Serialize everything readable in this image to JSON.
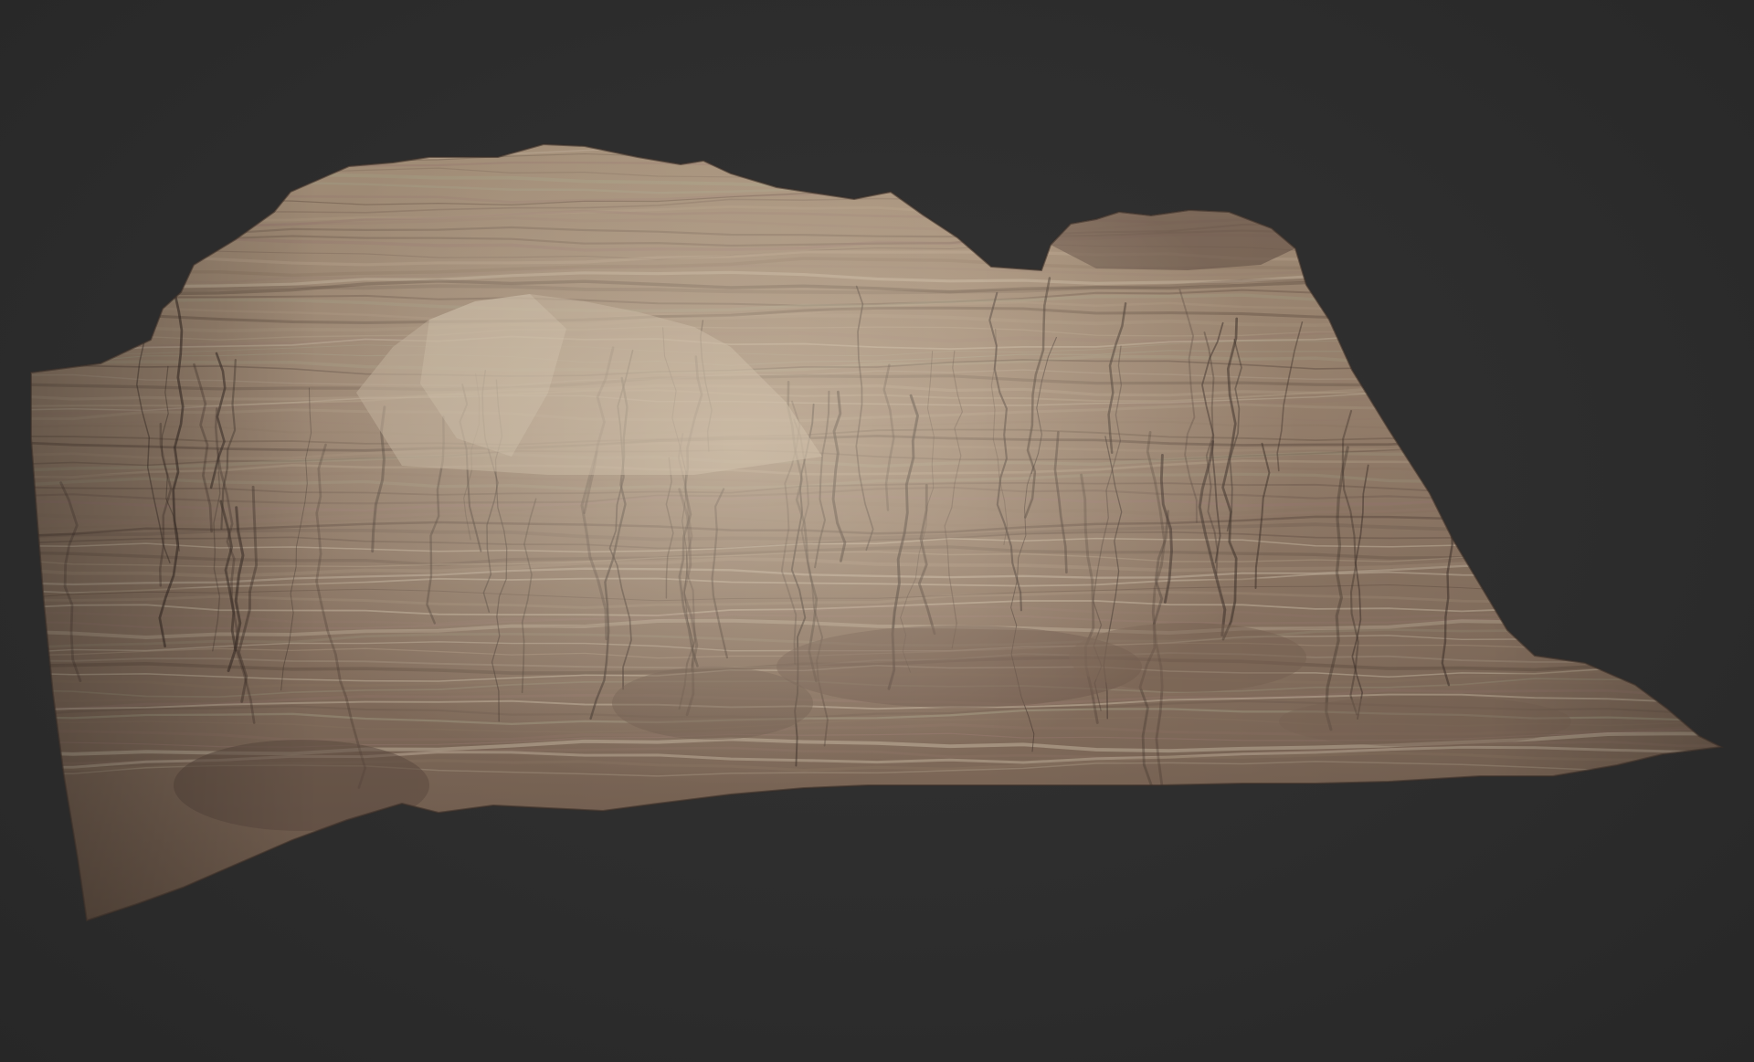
{
  "scene": {
    "background_color": "#2c2c2c",
    "subject": "terrain-mesh",
    "palette": {
      "rock_light": "#b8a48c",
      "rock_mid": "#8f7865",
      "rock_dark": "#5e4b3f",
      "rock_shadow": "#3d3029",
      "strata_pink": "#9a7b72",
      "strata_green": "#a9a48a",
      "highlight": "#d2c3ad"
    }
  }
}
